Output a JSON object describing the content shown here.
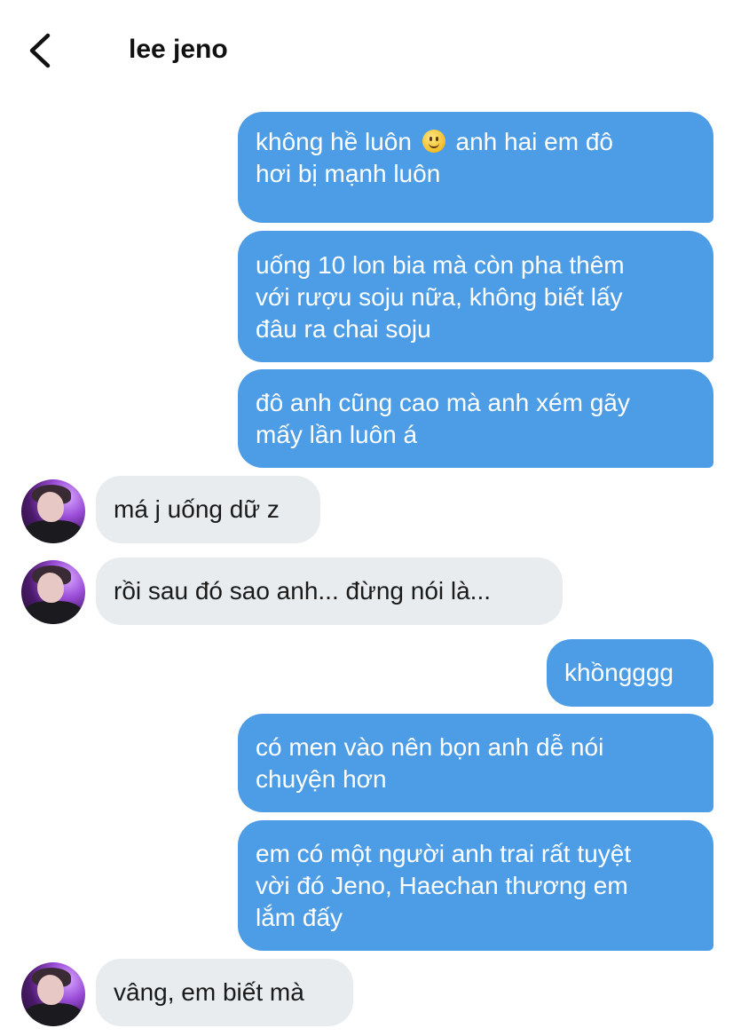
{
  "header": {
    "title": "lee jeno",
    "back_icon": "chevron-left-icon"
  },
  "colors": {
    "outgoing_bubble": "#4d9de6",
    "incoming_bubble": "#e9ecef",
    "outgoing_text": "#ffffff",
    "incoming_text": "#1a1a1a"
  },
  "messages": [
    {
      "sender": "me",
      "lines": [
        "không hề luôn",
        "anh hai em đô",
        "hơi bị mạnh luôn"
      ],
      "emoji": "slightly-smiling-face"
    },
    {
      "sender": "me",
      "lines": [
        "uống 10 lon bia mà còn pha thêm",
        "với rượu soju nữa, không biết lấy",
        "đâu ra chai soju"
      ]
    },
    {
      "sender": "me",
      "lines": [
        "đô anh cũng cao mà anh xém gãy",
        "mấy lần luôn á"
      ]
    },
    {
      "sender": "lee jeno",
      "lines": [
        "má j uống dữ z"
      ]
    },
    {
      "sender": "lee jeno",
      "lines": [
        "rồi sau đó sao anh... đừng nói là..."
      ]
    },
    {
      "sender": "me",
      "lines": [
        "khồngggg"
      ]
    },
    {
      "sender": "me",
      "lines": [
        "có men vào nên bọn anh dễ nói",
        "chuyện hơn"
      ]
    },
    {
      "sender": "me",
      "lines": [
        "em có một người anh trai rất tuyệt",
        "vời đó Jeno, Haechan thương em",
        "lắm đấy"
      ]
    },
    {
      "sender": "lee jeno",
      "lines": [
        "vâng, em biết mà"
      ]
    }
  ]
}
